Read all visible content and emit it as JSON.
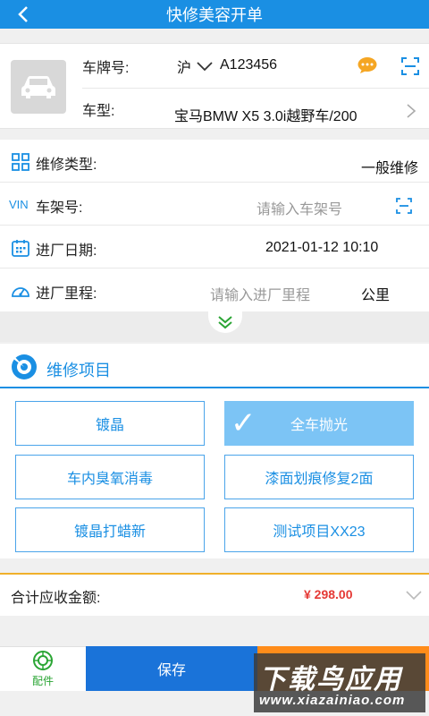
{
  "header": {
    "title": "快修美容开单"
  },
  "vehicle": {
    "plate_label": "车牌号:",
    "plate_prefix": "沪",
    "plate_number": "A123456",
    "model_label": "车型:",
    "model_value": "宝马BMW X5 3.0i越野车/200"
  },
  "form": {
    "repair_type_label": "维修类型:",
    "repair_type_value": "一般维修",
    "vin_badge": "VIN",
    "vin_label": "车架号:",
    "vin_placeholder": "请输入车架号",
    "date_label": "进厂日期:",
    "date_value": "2021-01-12 10:10",
    "mileage_label": "进厂里程:",
    "mileage_placeholder": "请输入进厂里程",
    "mileage_unit": "公里"
  },
  "items": {
    "title": "维修项目",
    "list": [
      {
        "label": "镀晶",
        "selected": false
      },
      {
        "label": "全车抛光",
        "selected": true
      },
      {
        "label": "车内臭氧消毒",
        "selected": false
      },
      {
        "label": "漆面划痕修复2面",
        "selected": false
      },
      {
        "label": "镀晶打蜡新",
        "selected": false
      },
      {
        "label": "测试项目XX23",
        "selected": false
      }
    ]
  },
  "total": {
    "label": "合计应收金额:",
    "amount": "¥ 298.00"
  },
  "footer": {
    "parts_label": "配件",
    "save_label": "保存"
  },
  "watermark": {
    "line1": "下载鸟应用",
    "line2": "www.xiazainiao.com"
  },
  "colors": {
    "primary": "#1a8fe3",
    "accent_orange": "#ff8c1a",
    "amount_red": "#e53935",
    "selected_item": "#7cc4f5"
  }
}
